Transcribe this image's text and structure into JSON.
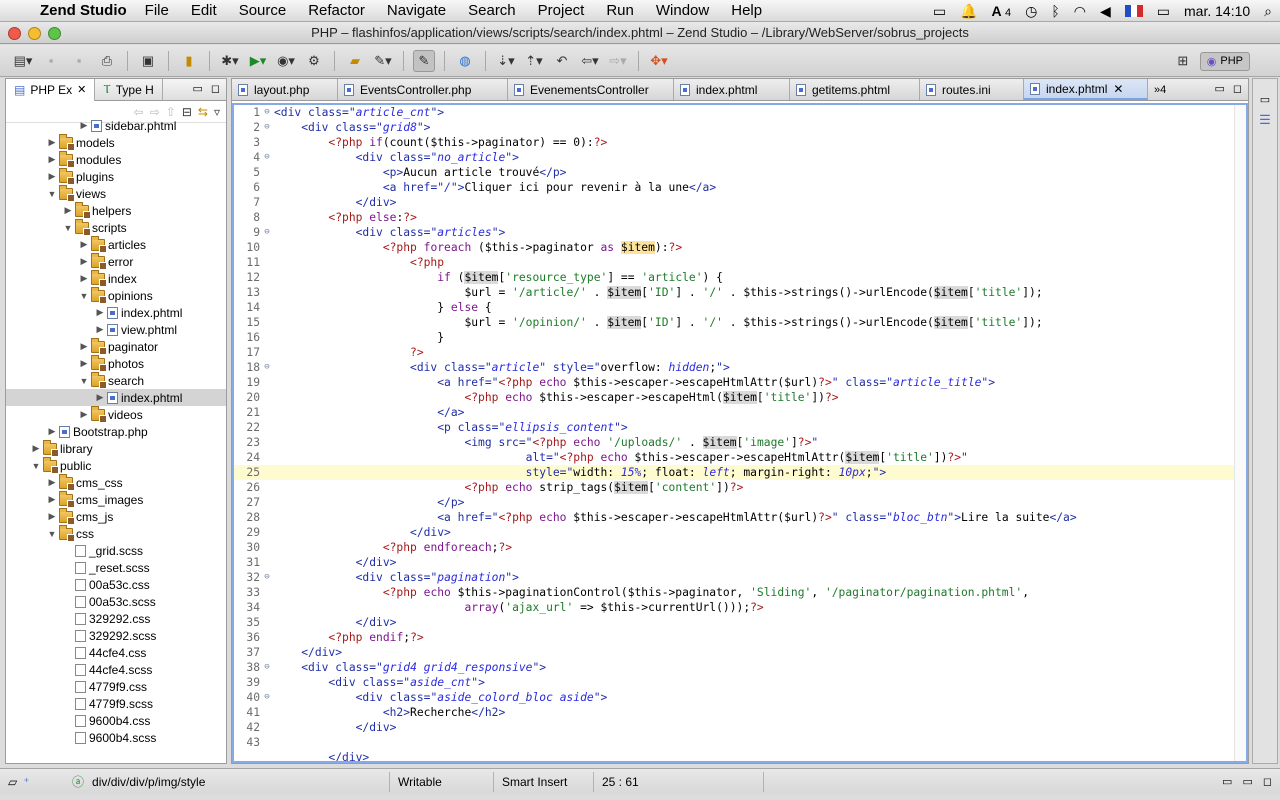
{
  "menubar": {
    "app_name": "Zend Studio",
    "items": [
      "File",
      "Edit",
      "Source",
      "Refactor",
      "Navigate",
      "Search",
      "Project",
      "Run",
      "Window",
      "Help"
    ],
    "clock": "mar. 14:10",
    "adobe_count": "4"
  },
  "window": {
    "title": "PHP – flashinfos/application/views/scripts/search/index.phtml – Zend Studio – /Library/WebServer/sobrus_projects"
  },
  "toolbar": {
    "perspective_label": "PHP"
  },
  "left_pane": {
    "tabs": [
      {
        "label": "PHP Ex",
        "close": "✕"
      },
      {
        "label": "Type H"
      }
    ]
  },
  "tree": [
    {
      "label": "sidebar.phtml",
      "level": 4,
      "type": "php",
      "twisty": "▶"
    },
    {
      "label": "models",
      "level": 2,
      "type": "pkg",
      "twisty": "▶"
    },
    {
      "label": "modules",
      "level": 2,
      "type": "pkg",
      "twisty": "▶"
    },
    {
      "label": "plugins",
      "level": 2,
      "type": "pkg",
      "twisty": "▶"
    },
    {
      "label": "views",
      "level": 2,
      "type": "pkg",
      "twisty": "▼"
    },
    {
      "label": "helpers",
      "level": 3,
      "type": "pkg",
      "twisty": "▶"
    },
    {
      "label": "scripts",
      "level": 3,
      "type": "pkg",
      "twisty": "▼"
    },
    {
      "label": "articles",
      "level": 4,
      "type": "pkg",
      "twisty": "▶"
    },
    {
      "label": "error",
      "level": 4,
      "type": "pkg",
      "twisty": "▶"
    },
    {
      "label": "index",
      "level": 4,
      "type": "pkg",
      "twisty": "▶"
    },
    {
      "label": "opinions",
      "level": 4,
      "type": "pkg",
      "twisty": "▼"
    },
    {
      "label": "index.phtml",
      "level": 5,
      "type": "php",
      "twisty": "▶"
    },
    {
      "label": "view.phtml",
      "level": 5,
      "type": "php",
      "twisty": "▶"
    },
    {
      "label": "paginator",
      "level": 4,
      "type": "pkg",
      "twisty": "▶"
    },
    {
      "label": "photos",
      "level": 4,
      "type": "pkg",
      "twisty": "▶"
    },
    {
      "label": "search",
      "level": 4,
      "type": "pkg",
      "twisty": "▼"
    },
    {
      "label": "index.phtml",
      "level": 5,
      "type": "php",
      "twisty": "▶",
      "selected": true
    },
    {
      "label": "videos",
      "level": 4,
      "type": "pkg",
      "twisty": "▶"
    },
    {
      "label": "Bootstrap.php",
      "level": 2,
      "type": "php",
      "twisty": "▶"
    },
    {
      "label": "library",
      "level": 1,
      "type": "pkg",
      "twisty": "▶"
    },
    {
      "label": "public",
      "level": 1,
      "type": "pkg",
      "twisty": "▼"
    },
    {
      "label": "cms_css",
      "level": 2,
      "type": "pkg",
      "twisty": "▶"
    },
    {
      "label": "cms_images",
      "level": 2,
      "type": "pkg",
      "twisty": "▶"
    },
    {
      "label": "cms_js",
      "level": 2,
      "type": "pkg",
      "twisty": "▶"
    },
    {
      "label": "css",
      "level": 2,
      "type": "pkg",
      "twisty": "▼"
    },
    {
      "label": "_grid.scss",
      "level": 3,
      "type": "css",
      "twisty": ""
    },
    {
      "label": "_reset.scss",
      "level": 3,
      "type": "css",
      "twisty": ""
    },
    {
      "label": "00a53c.css",
      "level": 3,
      "type": "css",
      "twisty": ""
    },
    {
      "label": "00a53c.scss",
      "level": 3,
      "type": "css",
      "twisty": ""
    },
    {
      "label": "329292.css",
      "level": 3,
      "type": "css",
      "twisty": ""
    },
    {
      "label": "329292.scss",
      "level": 3,
      "type": "css",
      "twisty": ""
    },
    {
      "label": "44cfe4.css",
      "level": 3,
      "type": "css",
      "twisty": ""
    },
    {
      "label": "44cfe4.scss",
      "level": 3,
      "type": "css",
      "twisty": ""
    },
    {
      "label": "4779f9.css",
      "level": 3,
      "type": "css",
      "twisty": ""
    },
    {
      "label": "4779f9.scss",
      "level": 3,
      "type": "css",
      "twisty": ""
    },
    {
      "label": "9600b4.css",
      "level": 3,
      "type": "css",
      "twisty": ""
    },
    {
      "label": "9600b4.scss",
      "level": 3,
      "type": "css",
      "twisty": ""
    }
  ],
  "editor_tabs": [
    {
      "label": "layout.php"
    },
    {
      "label": "EventsController.php"
    },
    {
      "label": "EvenementsController"
    },
    {
      "label": "index.phtml"
    },
    {
      "label": "getitems.phtml"
    },
    {
      "label": "routes.ini"
    },
    {
      "label": "index.phtml",
      "selected": true,
      "close": "✕"
    }
  ],
  "editor_overflow": "»4",
  "current_line": 25,
  "code": [
    [
      [
        "t",
        "<div "
      ],
      [
        "a",
        "class"
      ],
      [
        "t",
        "=\""
      ],
      [
        "v",
        "article_cnt"
      ],
      [
        "t",
        "\">"
      ]
    ],
    [
      [
        "i",
        "    "
      ],
      [
        "t",
        "<div "
      ],
      [
        "a",
        "class"
      ],
      [
        "t",
        "=\""
      ],
      [
        "v",
        "grid8"
      ],
      [
        "t",
        "\">"
      ]
    ],
    [
      [
        "i",
        "        "
      ],
      [
        "p",
        "<?php "
      ],
      [
        "k",
        "if"
      ],
      [
        "n",
        "(count($this->paginator) == 0):"
      ],
      [
        "p",
        "?>"
      ]
    ],
    [
      [
        "i",
        "            "
      ],
      [
        "t",
        "<div "
      ],
      [
        "a",
        "class"
      ],
      [
        "t",
        "=\""
      ],
      [
        "v",
        "no_article"
      ],
      [
        "t",
        "\">"
      ]
    ],
    [
      [
        "i",
        "                "
      ],
      [
        "t",
        "<p>"
      ],
      [
        "n",
        "Aucun article trouvé"
      ],
      [
        "t",
        "</p>"
      ]
    ],
    [
      [
        "i",
        "                "
      ],
      [
        "t",
        "<a "
      ],
      [
        "a",
        "href"
      ],
      [
        "t",
        "=\""
      ],
      [
        "v",
        "/"
      ],
      [
        "t",
        "\">"
      ],
      [
        "n",
        "Cliquer ici pour revenir à la une"
      ],
      [
        "t",
        "</a>"
      ]
    ],
    [
      [
        "i",
        "            "
      ],
      [
        "t",
        "</div>"
      ]
    ],
    [
      [
        "i",
        "        "
      ],
      [
        "p",
        "<?php "
      ],
      [
        "k",
        "else"
      ],
      [
        "n",
        ":"
      ],
      [
        "p",
        "?>"
      ]
    ],
    [
      [
        "i",
        "            "
      ],
      [
        "t",
        "<div "
      ],
      [
        "a",
        "class"
      ],
      [
        "t",
        "=\""
      ],
      [
        "v",
        "articles"
      ],
      [
        "t",
        "\">"
      ]
    ],
    [
      [
        "i",
        "                "
      ],
      [
        "p",
        "<?php "
      ],
      [
        "k",
        "foreach"
      ],
      [
        "n",
        " ($this->paginator "
      ],
      [
        "k",
        "as"
      ],
      [
        "n",
        " "
      ],
      [
        "o",
        "$item"
      ],
      [
        "n",
        "):"
      ],
      [
        "p",
        "?>"
      ]
    ],
    [
      [
        "i",
        "                    "
      ],
      [
        "p",
        "<?php"
      ]
    ],
    [
      [
        "i",
        "                        "
      ],
      [
        "k",
        "if"
      ],
      [
        "n",
        " ("
      ],
      [
        "h",
        "$item"
      ],
      [
        "n",
        "["
      ],
      [
        "s",
        "'resource_type'"
      ],
      [
        "n",
        "] == "
      ],
      [
        "s",
        "'article'"
      ],
      [
        "n",
        ") {"
      ]
    ],
    [
      [
        "i",
        "                            "
      ],
      [
        "n",
        "$url = "
      ],
      [
        "s",
        "'/article/'"
      ],
      [
        "n",
        " . "
      ],
      [
        "h",
        "$item"
      ],
      [
        "n",
        "["
      ],
      [
        "s",
        "'ID'"
      ],
      [
        "n",
        "] . "
      ],
      [
        "s",
        "'/'"
      ],
      [
        "n",
        " . $this->strings()->urlEncode("
      ],
      [
        "h",
        "$item"
      ],
      [
        "n",
        "["
      ],
      [
        "s",
        "'title'"
      ],
      [
        "n",
        "]);"
      ]
    ],
    [
      [
        "i",
        "                        "
      ],
      [
        "n",
        "} "
      ],
      [
        "k",
        "else"
      ],
      [
        "n",
        " {"
      ]
    ],
    [
      [
        "i",
        "                            "
      ],
      [
        "n",
        "$url = "
      ],
      [
        "s",
        "'/opinion/'"
      ],
      [
        "n",
        " . "
      ],
      [
        "h",
        "$item"
      ],
      [
        "n",
        "["
      ],
      [
        "s",
        "'ID'"
      ],
      [
        "n",
        "] . "
      ],
      [
        "s",
        "'/'"
      ],
      [
        "n",
        " . $this->strings()->urlEncode("
      ],
      [
        "h",
        "$item"
      ],
      [
        "n",
        "["
      ],
      [
        "s",
        "'title'"
      ],
      [
        "n",
        "]);"
      ]
    ],
    [
      [
        "i",
        "                        "
      ],
      [
        "n",
        "}"
      ]
    ],
    [
      [
        "i",
        "                    "
      ],
      [
        "p",
        "?>"
      ]
    ],
    [
      [
        "i",
        "                    "
      ],
      [
        "t",
        "<div "
      ],
      [
        "a",
        "class"
      ],
      [
        "t",
        "=\""
      ],
      [
        "v",
        "article"
      ],
      [
        "t",
        "\" "
      ],
      [
        "a",
        "style"
      ],
      [
        "t",
        "=\""
      ],
      [
        "n",
        "overflow: "
      ],
      [
        "v",
        "hidden"
      ],
      [
        "n",
        ";"
      ],
      [
        "t",
        "\">"
      ]
    ],
    [
      [
        "i",
        "                        "
      ],
      [
        "t",
        "<a "
      ],
      [
        "a",
        "href"
      ],
      [
        "t",
        "=\""
      ],
      [
        "p",
        "<?php "
      ],
      [
        "k",
        "echo"
      ],
      [
        "n",
        " $this->escaper->escapeHtmlAttr($url)"
      ],
      [
        "p",
        "?>"
      ],
      [
        "t",
        "\" "
      ],
      [
        "a",
        "class"
      ],
      [
        "t",
        "=\""
      ],
      [
        "v",
        "article_title"
      ],
      [
        "t",
        "\">"
      ]
    ],
    [
      [
        "i",
        "                            "
      ],
      [
        "p",
        "<?php "
      ],
      [
        "k",
        "echo"
      ],
      [
        "n",
        " $this->escaper->escapeHtml("
      ],
      [
        "h",
        "$item"
      ],
      [
        "n",
        "["
      ],
      [
        "s",
        "'title'"
      ],
      [
        "n",
        "])"
      ],
      [
        "p",
        "?>"
      ]
    ],
    [
      [
        "i",
        "                        "
      ],
      [
        "t",
        "</a>"
      ]
    ],
    [
      [
        "i",
        "                        "
      ],
      [
        "t",
        "<p "
      ],
      [
        "a",
        "class"
      ],
      [
        "t",
        "=\""
      ],
      [
        "v",
        "ellipsis_content"
      ],
      [
        "t",
        "\">"
      ]
    ],
    [
      [
        "i",
        "                            "
      ],
      [
        "t",
        "<img "
      ],
      [
        "a",
        "src"
      ],
      [
        "t",
        "=\""
      ],
      [
        "p",
        "<?php "
      ],
      [
        "k",
        "echo"
      ],
      [
        "n",
        " "
      ],
      [
        "s",
        "'/uploads/'"
      ],
      [
        "n",
        " . "
      ],
      [
        "h",
        "$item"
      ],
      [
        "n",
        "["
      ],
      [
        "s",
        "'image'"
      ],
      [
        "n",
        "]"
      ],
      [
        "p",
        "?>"
      ],
      [
        "t",
        "\""
      ]
    ],
    [
      [
        "i",
        "                                     "
      ],
      [
        "a",
        "alt"
      ],
      [
        "t",
        "=\""
      ],
      [
        "p",
        "<?php "
      ],
      [
        "k",
        "echo"
      ],
      [
        "n",
        " $this->escaper->escapeHtmlAttr("
      ],
      [
        "h",
        "$item"
      ],
      [
        "n",
        "["
      ],
      [
        "s",
        "'title'"
      ],
      [
        "n",
        "])"
      ],
      [
        "p",
        "?>"
      ],
      [
        "t",
        "\""
      ]
    ],
    [
      [
        "i",
        "                                     "
      ],
      [
        "a",
        "style"
      ],
      [
        "t",
        "=\""
      ],
      [
        "n",
        "width: "
      ],
      [
        "v",
        "15%"
      ],
      [
        "n",
        "; float: "
      ],
      [
        "v",
        "left"
      ],
      [
        "n",
        "; margin-right: "
      ],
      [
        "v",
        "10px"
      ],
      [
        "n",
        ";"
      ],
      [
        "t",
        "\">"
      ]
    ],
    [
      [
        "i",
        "                            "
      ],
      [
        "p",
        "<?php "
      ],
      [
        "k",
        "echo"
      ],
      [
        "n",
        " strip_tags("
      ],
      [
        "h",
        "$item"
      ],
      [
        "n",
        "["
      ],
      [
        "s",
        "'content'"
      ],
      [
        "n",
        "])"
      ],
      [
        "p",
        "?>"
      ]
    ],
    [
      [
        "i",
        "                        "
      ],
      [
        "t",
        "</p>"
      ]
    ],
    [
      [
        "i",
        "                        "
      ],
      [
        "t",
        "<a "
      ],
      [
        "a",
        "href"
      ],
      [
        "t",
        "=\""
      ],
      [
        "p",
        "<?php "
      ],
      [
        "k",
        "echo"
      ],
      [
        "n",
        " $this->escaper->escapeHtmlAttr($url)"
      ],
      [
        "p",
        "?>"
      ],
      [
        "t",
        "\" "
      ],
      [
        "a",
        "class"
      ],
      [
        "t",
        "=\""
      ],
      [
        "v",
        "bloc_btn"
      ],
      [
        "t",
        "\">"
      ],
      [
        "n",
        "Lire la suite"
      ],
      [
        "t",
        "</a>"
      ]
    ],
    [
      [
        "i",
        "                    "
      ],
      [
        "t",
        "</div>"
      ]
    ],
    [
      [
        "i",
        "                "
      ],
      [
        "p",
        "<?php "
      ],
      [
        "k",
        "endforeach"
      ],
      [
        "n",
        ";"
      ],
      [
        "p",
        "?>"
      ]
    ],
    [
      [
        "i",
        "            "
      ],
      [
        "t",
        "</div>"
      ]
    ],
    [
      [
        "i",
        "            "
      ],
      [
        "t",
        "<div "
      ],
      [
        "a",
        "class"
      ],
      [
        "t",
        "=\""
      ],
      [
        "v",
        "pagination"
      ],
      [
        "t",
        "\">"
      ]
    ],
    [
      [
        "i",
        "                "
      ],
      [
        "p",
        "<?php "
      ],
      [
        "k",
        "echo"
      ],
      [
        "n",
        " $this->paginationControl($this->paginator, "
      ],
      [
        "s",
        "'Sliding'"
      ],
      [
        "n",
        ", "
      ],
      [
        "s",
        "'/paginator/pagination.phtml'"
      ],
      [
        "n",
        ","
      ]
    ],
    [
      [
        "i",
        "                            "
      ],
      [
        "k",
        "array"
      ],
      [
        "n",
        "("
      ],
      [
        "s",
        "'ajax_url'"
      ],
      [
        "n",
        " => $this->currentUrl()));"
      ],
      [
        "p",
        "?>"
      ]
    ],
    [
      [
        "i",
        "            "
      ],
      [
        "t",
        "</div>"
      ]
    ],
    [
      [
        "i",
        "        "
      ],
      [
        "p",
        "<?php "
      ],
      [
        "k",
        "endif"
      ],
      [
        "n",
        ";"
      ],
      [
        "p",
        "?>"
      ]
    ],
    [
      [
        "i",
        "    "
      ],
      [
        "t",
        "</div>"
      ]
    ],
    [
      [
        "i",
        "    "
      ],
      [
        "t",
        "<div "
      ],
      [
        "a",
        "class"
      ],
      [
        "t",
        "=\""
      ],
      [
        "v",
        "grid4 grid4_responsive"
      ],
      [
        "t",
        "\">"
      ]
    ],
    [
      [
        "i",
        "        "
      ],
      [
        "t",
        "<div "
      ],
      [
        "a",
        "class"
      ],
      [
        "t",
        "=\""
      ],
      [
        "v",
        "aside_cnt"
      ],
      [
        "t",
        "\">"
      ]
    ],
    [
      [
        "i",
        "            "
      ],
      [
        "t",
        "<div "
      ],
      [
        "a",
        "class"
      ],
      [
        "t",
        "=\""
      ],
      [
        "v",
        "aside_colord_bloc aside"
      ],
      [
        "t",
        "\">"
      ]
    ],
    [
      [
        "i",
        "                "
      ],
      [
        "t",
        "<h2>"
      ],
      [
        "n",
        "Recherche"
      ],
      [
        "t",
        "</h2>"
      ]
    ],
    [
      [
        "i",
        "            "
      ],
      [
        "t",
        "</div>"
      ]
    ],
    [
      [
        "i",
        ""
      ]
    ],
    [
      [
        "i",
        "        "
      ],
      [
        "t",
        "</div>"
      ]
    ]
  ],
  "line_numbers": [
    "1",
    "2",
    "3",
    "4",
    "5",
    "6",
    "7",
    "8",
    "9",
    "10",
    "11",
    "12",
    "13",
    "14",
    "15",
    "16",
    "17",
    "18",
    "19",
    "20",
    "21",
    "22",
    "23",
    "24",
    "25",
    "26",
    "27",
    "28",
    "29",
    "30",
    "31",
    "32",
    "33",
    "34",
    "35",
    "36",
    "37",
    "38",
    "39",
    "40",
    "41",
    "42",
    "43",
    ""
  ],
  "fold_markers": {
    "1": "⊖",
    "2": "⊖",
    "4": "⊖",
    "9": "⊖",
    "18": "⊖",
    "32": "⊖",
    "38": "⊖",
    "40": "⊖"
  },
  "status": {
    "breadcrumb": "div/div/div/p/img/style",
    "mode": "Writable",
    "insert": "Smart Insert",
    "position": "25 : 61"
  }
}
